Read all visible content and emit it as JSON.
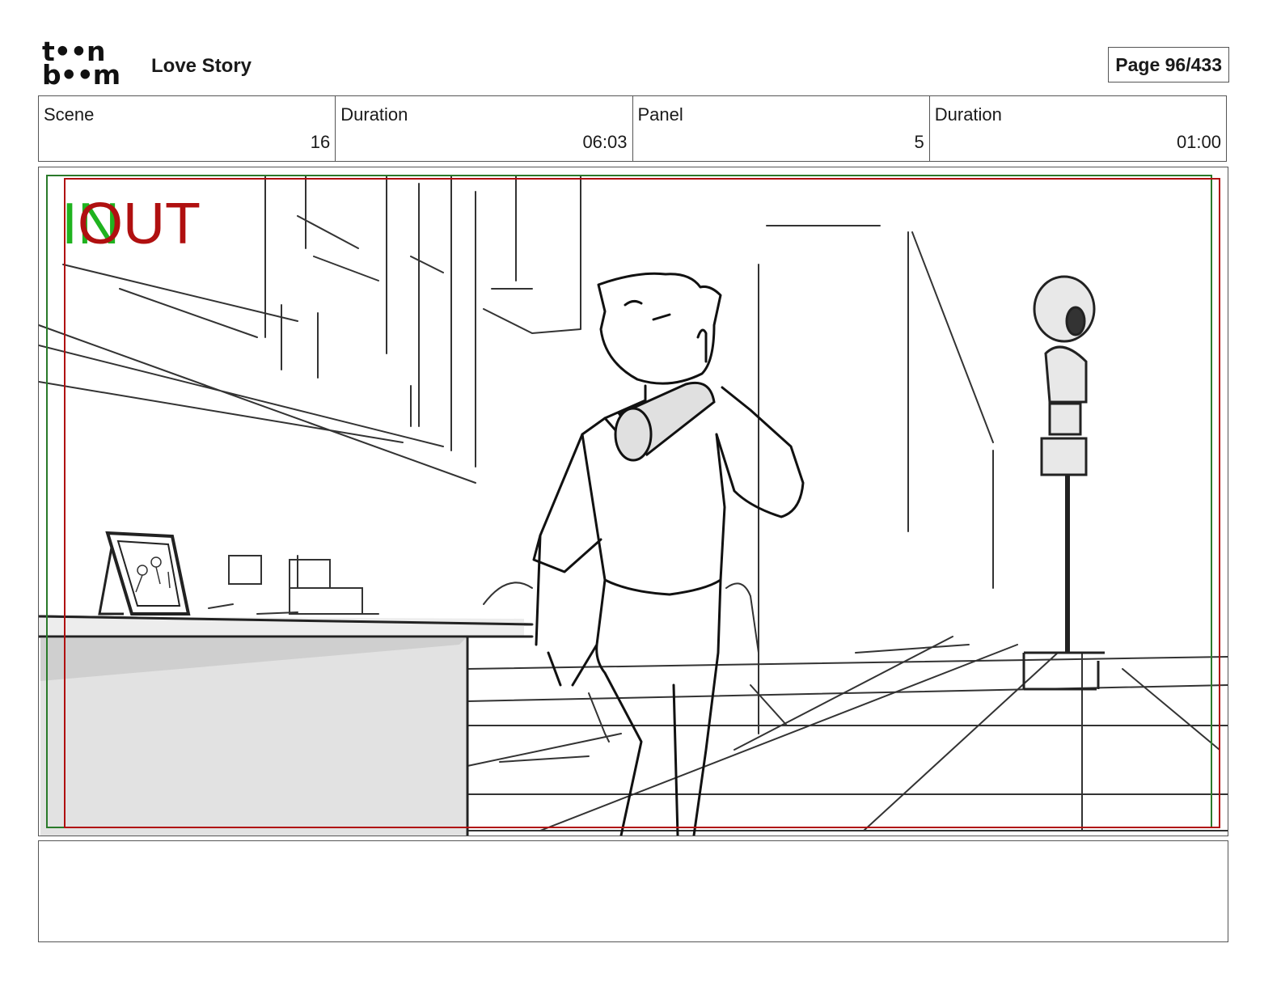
{
  "header": {
    "logo_line1": "t••n",
    "logo_line2": "b••m",
    "project_title": "Love Story",
    "page_label": "Page 96/433"
  },
  "info": {
    "scene_label": "Scene",
    "scene_value": "16",
    "scene_duration_label": "Duration",
    "scene_duration_value": "06:03",
    "panel_label": "Panel",
    "panel_value": "5",
    "panel_duration_label": "Duration",
    "panel_duration_value": "01:00"
  },
  "frame": {
    "in_label": "IN",
    "out_label": "OUT",
    "in_color": "#1fb31f",
    "out_color": "#b01010"
  },
  "notes": {
    "text": ""
  }
}
